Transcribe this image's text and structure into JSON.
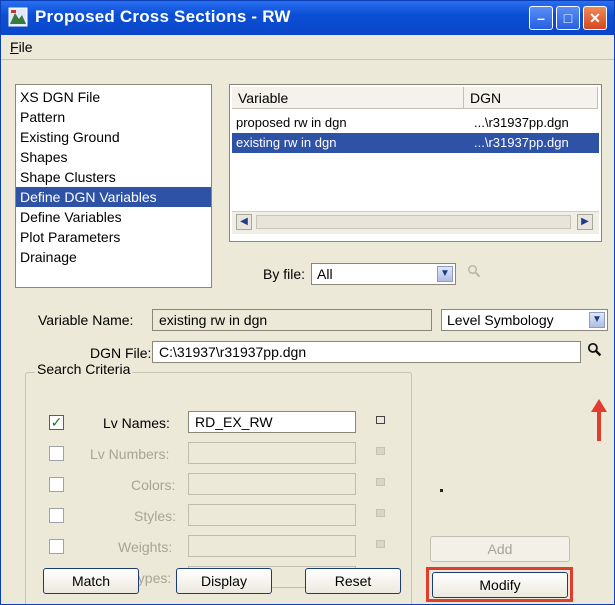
{
  "window": {
    "title": "Proposed Cross Sections - RW",
    "menu": {
      "file": "File",
      "file_mnemonic": "F",
      "file_rest": "ile"
    }
  },
  "sidebar": {
    "items": [
      {
        "label": "XS DGN File",
        "selected": false
      },
      {
        "label": "Pattern",
        "selected": false
      },
      {
        "label": "Existing Ground",
        "selected": false
      },
      {
        "label": "Shapes",
        "selected": false
      },
      {
        "label": "Shape Clusters",
        "selected": false
      },
      {
        "label": "Define DGN Variables",
        "selected": true
      },
      {
        "label": "Define Variables",
        "selected": false
      },
      {
        "label": "Plot Parameters",
        "selected": false
      },
      {
        "label": "Drainage",
        "selected": false
      }
    ]
  },
  "variables_table": {
    "columns": [
      "Variable",
      "DGN"
    ],
    "rows": [
      {
        "variable": "proposed rw in dgn",
        "dgn": "...\\r31937pp.dgn",
        "selected": false
      },
      {
        "variable": "existing rw in dgn",
        "dgn": "...\\r31937pp.dgn",
        "selected": true
      }
    ]
  },
  "by_file": {
    "label": "By file:",
    "value": "All"
  },
  "variable_name": {
    "label": "Variable Name:",
    "value": "existing rw in dgn"
  },
  "symbology_select": {
    "value": "Level Symbology"
  },
  "dgn_file": {
    "label": "DGN File:",
    "value": "C:\\31937\\r31937pp.dgn"
  },
  "search_criteria": {
    "title": "Search Criteria",
    "rows": [
      {
        "label": "Lv Names:",
        "value": "RD_EX_RW",
        "checked": true,
        "enabled": true
      },
      {
        "label": "Lv Numbers:",
        "value": "",
        "checked": false,
        "enabled": false
      },
      {
        "label": "Colors:",
        "value": "",
        "checked": false,
        "enabled": false
      },
      {
        "label": "Styles:",
        "value": "",
        "checked": false,
        "enabled": false
      },
      {
        "label": "Weights:",
        "value": "",
        "checked": false,
        "enabled": false
      },
      {
        "label": "Types:",
        "value": "",
        "checked": false,
        "enabled": false
      }
    ]
  },
  "buttons": {
    "match": "Match",
    "display": "Display",
    "reset": "Reset",
    "add": "Add",
    "modify": "Modify"
  },
  "colors": {
    "selection": "#2e52a6",
    "annotation_red": "#e23c2e",
    "titlebar": "#0b4fd6"
  },
  "icons": {
    "app": "cross-section-app-icon",
    "browse": "magnifier-icon",
    "search": "magnifier-icon",
    "arrow_annotation": "red-up-arrow-icon"
  }
}
